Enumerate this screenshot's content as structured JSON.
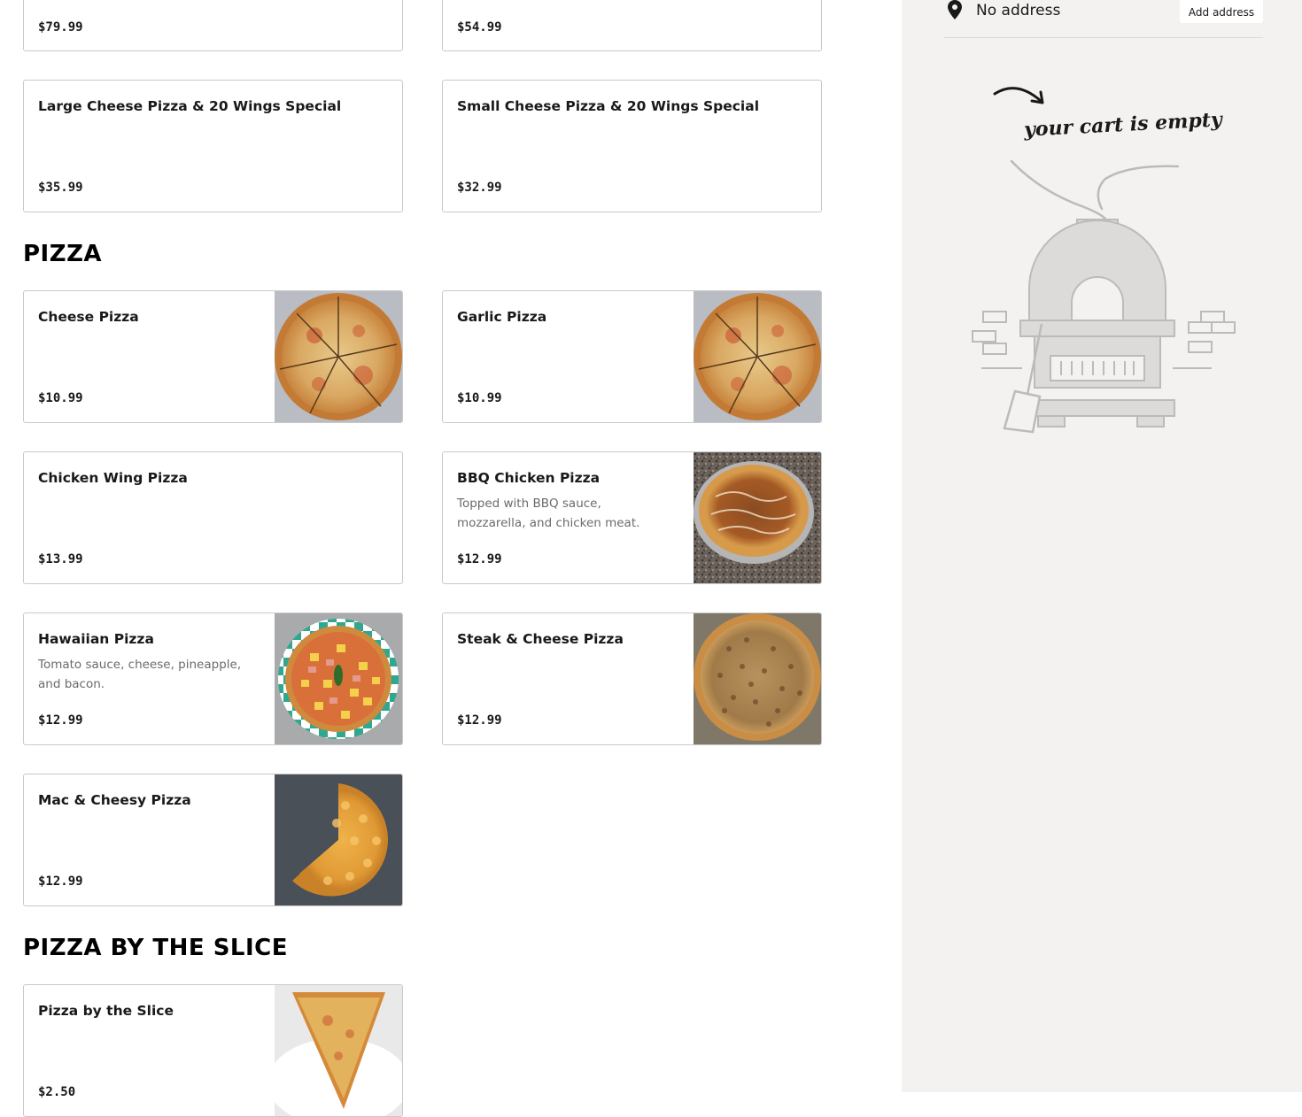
{
  "top_specials": [
    {
      "price": "$79.99"
    },
    {
      "price": "$54.99"
    },
    {
      "name": "Large Cheese Pizza & 20 Wings Special",
      "price": "$35.99"
    },
    {
      "name": "Small Cheese Pizza & 20 Wings Special",
      "price": "$32.99"
    }
  ],
  "sections": {
    "pizza": {
      "title": "PIZZA",
      "items": [
        {
          "name": "Cheese Pizza",
          "price": "$10.99"
        },
        {
          "name": "Garlic Pizza",
          "price": "$10.99"
        },
        {
          "name": "Chicken Wing Pizza",
          "price": "$13.99"
        },
        {
          "name": "BBQ Chicken Pizza",
          "desc": "Topped with BBQ sauce, mozzarella, and chicken meat.",
          "price": "$12.99"
        },
        {
          "name": "Hawaiian Pizza",
          "desc": "Tomato sauce, cheese, pineapple, and bacon.",
          "price": "$12.99"
        },
        {
          "name": "Steak & Cheese Pizza",
          "price": "$12.99"
        },
        {
          "name": "Mac & Cheesy Pizza",
          "price": "$12.99"
        }
      ]
    },
    "slice": {
      "title": "PIZZA BY THE SLICE",
      "items": [
        {
          "name": "Pizza by the Slice",
          "price": "$2.50"
        }
      ]
    }
  },
  "sidebar": {
    "address_text": "No address",
    "add_address_label": "Add address",
    "empty_cart_text": "your cart is empty",
    "icons": [
      "location-pin-icon",
      "arrow-icon"
    ]
  },
  "colors": {
    "sidebar_bg": "#f3f2f0",
    "card_border": "#c9c9c9",
    "text": "#191919",
    "muted": "#6b6b6b"
  }
}
